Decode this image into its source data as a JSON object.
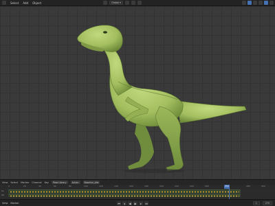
{
  "app": {
    "menu": [
      "Select",
      "Add",
      "Object"
    ],
    "view_mode": "Global",
    "colors": {
      "accent": "#4772b3",
      "bg": "#3a3a3a",
      "dino_body": "#a9c467",
      "dino_shadow": "#6c8a38",
      "keyframe": "#e0b040"
    }
  },
  "timeline": {
    "menu": [
      "View",
      "Select",
      "Marker",
      "Channel",
      "Key"
    ],
    "chips": [
      "Pose Library",
      "Action",
      "Baseline_Idle"
    ],
    "ruler_ticks": [
      "0",
      "20",
      "40",
      "60",
      "80",
      "100",
      "120",
      "140",
      "160",
      "180",
      "200",
      "220",
      "240",
      "260",
      "280",
      "300"
    ],
    "current_frame": "256",
    "track_labels": [
      "Su",
      "Ob"
    ]
  },
  "status": {
    "left": [
      "View",
      "Marker"
    ],
    "start": "1",
    "end": "270"
  },
  "icons": [
    "menu-icon",
    "globe-icon",
    "grid-icon",
    "camera-icon",
    "play-icon",
    "pause-icon",
    "skip-start-icon",
    "skip-end-icon",
    "keyframe-icon"
  ]
}
